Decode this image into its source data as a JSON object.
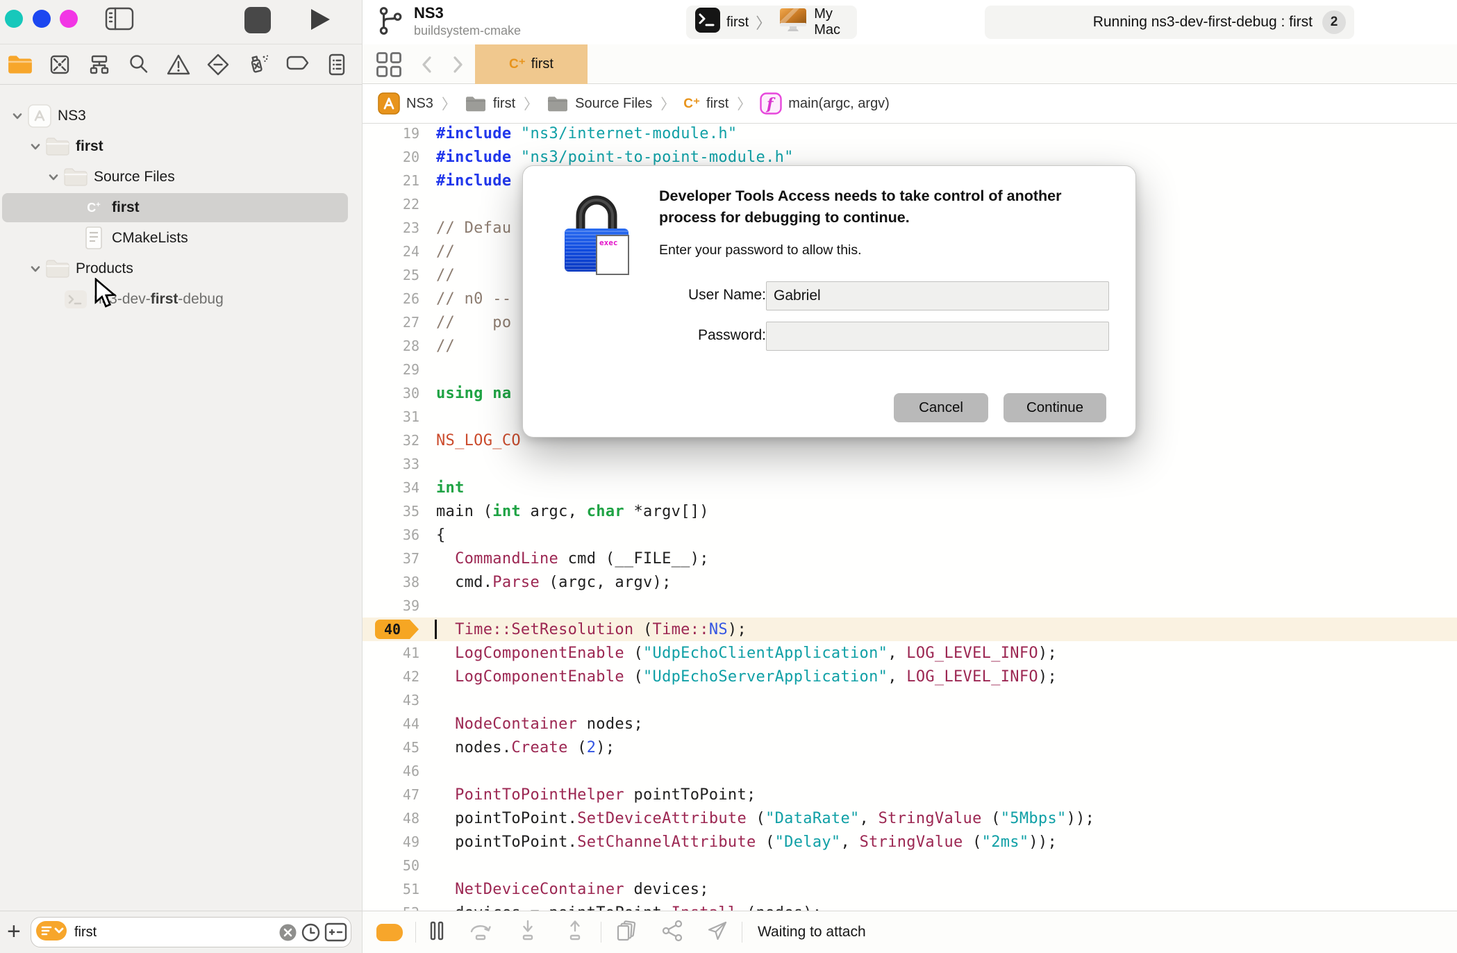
{
  "traffic_lights": {
    "close": "#17c8bb",
    "minimize": "#1c47f0",
    "zoom": "#f235e5"
  },
  "toolbar": {
    "project_name": "NS3",
    "project_subtitle": "buildsystem-cmake",
    "scheme_target": "first",
    "scheme_separator": "〉",
    "scheme_device": "My Mac",
    "status_text": "Running ns3-dev-first-debug : first",
    "status_badge": "2"
  },
  "navigator_icons": [
    {
      "name": "project-navigator-icon",
      "active": true
    },
    {
      "name": "changes-navigator-icon",
      "active": false
    },
    {
      "name": "symbols-navigator-icon",
      "active": false
    },
    {
      "name": "find-navigator-icon",
      "active": false
    },
    {
      "name": "issues-navigator-icon",
      "active": false
    },
    {
      "name": "tests-navigator-icon",
      "active": false
    },
    {
      "name": "debug-navigator-icon",
      "active": false
    },
    {
      "name": "breakpoints-navigator-icon",
      "active": false
    },
    {
      "name": "reports-navigator-icon",
      "active": false
    }
  ],
  "tabbar": {
    "file_badge": "C⁺",
    "active_tab": "first"
  },
  "breadcrumb": [
    {
      "icon": "app",
      "label": "NS3"
    },
    {
      "icon": "folder-sm",
      "label": "first"
    },
    {
      "icon": "folder-sm",
      "label": "Source Files"
    },
    {
      "icon": "cpp-sm",
      "label": "first"
    },
    {
      "icon": "func",
      "label": "main(argc, argv)"
    }
  ],
  "sidebar": {
    "tree": [
      {
        "label": "NS3",
        "icon": "project",
        "level": 0,
        "disclosure": true,
        "bold": false,
        "selected": false
      },
      {
        "label": "first",
        "icon": "folder",
        "level": 1,
        "disclosure": true,
        "bold": true,
        "selected": false
      },
      {
        "label": "Source Files",
        "icon": "folder",
        "level": 2,
        "disclosure": true,
        "bold": false,
        "selected": false
      },
      {
        "label": "first",
        "icon": "cpp",
        "level": 3,
        "disclosure": false,
        "bold": true,
        "selected": true
      },
      {
        "label": "CMakeLists",
        "icon": "doc",
        "level": 3,
        "disclosure": false,
        "bold": false,
        "selected": false
      },
      {
        "label": "Products",
        "icon": "folder",
        "level": 1,
        "disclosure": true,
        "bold": false,
        "selected": false
      },
      {
        "label": "ns3-dev-first-debug",
        "icon": "product",
        "level": 2,
        "disclosure": false,
        "bold": false,
        "selected": false,
        "dim": true,
        "parts": [
          {
            "t": "ns3-dev-",
            "b": false
          },
          {
            "t": "first",
            "b": true
          },
          {
            "t": "-debug",
            "b": false
          }
        ]
      }
    ],
    "filter_value": "first"
  },
  "editor": {
    "current_line": 40,
    "lines": [
      {
        "n": 19,
        "tokens": [
          [
            "pre",
            "#include"
          ],
          [
            "pl",
            " "
          ],
          [
            "str",
            "\"ns3/internet-module.h\""
          ]
        ]
      },
      {
        "n": 20,
        "tokens": [
          [
            "pre",
            "#include"
          ],
          [
            "pl",
            " "
          ],
          [
            "str",
            "\"ns3/point-to-point-module.h\""
          ]
        ]
      },
      {
        "n": 21,
        "tokens": [
          [
            "pre",
            "#include"
          ]
        ]
      },
      {
        "n": 22,
        "tokens": []
      },
      {
        "n": 23,
        "tokens": [
          [
            "com",
            "// Defau"
          ]
        ]
      },
      {
        "n": 24,
        "tokens": [
          [
            "com",
            "//"
          ]
        ]
      },
      {
        "n": 25,
        "tokens": [
          [
            "com",
            "//"
          ]
        ]
      },
      {
        "n": 26,
        "tokens": [
          [
            "com",
            "// n0 --"
          ]
        ]
      },
      {
        "n": 27,
        "tokens": [
          [
            "com",
            "//    po"
          ]
        ]
      },
      {
        "n": 28,
        "tokens": [
          [
            "com",
            "//"
          ]
        ]
      },
      {
        "n": 29,
        "tokens": []
      },
      {
        "n": 30,
        "tokens": [
          [
            "kw",
            "using na"
          ]
        ]
      },
      {
        "n": 31,
        "tokens": []
      },
      {
        "n": 32,
        "tokens": [
          [
            "mac",
            "NS_LOG_CO"
          ]
        ]
      },
      {
        "n": 33,
        "tokens": []
      },
      {
        "n": 34,
        "tokens": [
          [
            "kw",
            "int"
          ]
        ]
      },
      {
        "n": 35,
        "tokens": [
          [
            "pl",
            "main ("
          ],
          [
            "kw",
            "int"
          ],
          [
            "pl",
            " argc, "
          ],
          [
            "kw",
            "char"
          ],
          [
            "pl",
            " *argv[])"
          ]
        ]
      },
      {
        "n": 36,
        "tokens": [
          [
            "pl",
            "{"
          ]
        ]
      },
      {
        "n": 37,
        "tokens": [
          [
            "pl",
            "  "
          ],
          [
            "ty",
            "CommandLine"
          ],
          [
            "pl",
            " cmd (__FILE__);"
          ]
        ]
      },
      {
        "n": 38,
        "tokens": [
          [
            "pl",
            "  cmd."
          ],
          [
            "ty",
            "Parse"
          ],
          [
            "pl",
            " (argc, argv);"
          ]
        ]
      },
      {
        "n": 39,
        "tokens": []
      },
      {
        "n": 40,
        "hl": true,
        "tokens": [
          [
            "pl",
            "  "
          ],
          [
            "ty",
            "Time::SetResolution"
          ],
          [
            "pl",
            " ("
          ],
          [
            "ty",
            "Time::"
          ],
          [
            "num",
            "NS"
          ],
          [
            "pl",
            ");"
          ]
        ]
      },
      {
        "n": 41,
        "tokens": [
          [
            "pl",
            "  "
          ],
          [
            "ty",
            "LogComponentEnable"
          ],
          [
            "pl",
            " ("
          ],
          [
            "str",
            "\"UdpEchoClientApplication\""
          ],
          [
            "pl",
            ", "
          ],
          [
            "ty",
            "LOG_LEVEL_INFO"
          ],
          [
            "pl",
            ");"
          ]
        ]
      },
      {
        "n": 42,
        "tokens": [
          [
            "pl",
            "  "
          ],
          [
            "ty",
            "LogComponentEnable"
          ],
          [
            "pl",
            " ("
          ],
          [
            "str",
            "\"UdpEchoServerApplication\""
          ],
          [
            "pl",
            ", "
          ],
          [
            "ty",
            "LOG_LEVEL_INFO"
          ],
          [
            "pl",
            ");"
          ]
        ]
      },
      {
        "n": 43,
        "tokens": []
      },
      {
        "n": 44,
        "tokens": [
          [
            "pl",
            "  "
          ],
          [
            "ty",
            "NodeContainer"
          ],
          [
            "pl",
            " nodes;"
          ]
        ]
      },
      {
        "n": 45,
        "tokens": [
          [
            "pl",
            "  nodes."
          ],
          [
            "ty",
            "Create"
          ],
          [
            "pl",
            " ("
          ],
          [
            "num",
            "2"
          ],
          [
            "pl",
            ");"
          ]
        ]
      },
      {
        "n": 46,
        "tokens": []
      },
      {
        "n": 47,
        "tokens": [
          [
            "pl",
            "  "
          ],
          [
            "ty",
            "PointToPointHelper"
          ],
          [
            "pl",
            " pointToPoint;"
          ]
        ]
      },
      {
        "n": 48,
        "tokens": [
          [
            "pl",
            "  pointToPoint."
          ],
          [
            "ty",
            "SetDeviceAttribute"
          ],
          [
            "pl",
            " ("
          ],
          [
            "str",
            "\"DataRate\""
          ],
          [
            "pl",
            ", "
          ],
          [
            "ty",
            "StringValue"
          ],
          [
            "pl",
            " ("
          ],
          [
            "str",
            "\"5Mbps\""
          ],
          [
            "pl",
            "));"
          ]
        ]
      },
      {
        "n": 49,
        "tokens": [
          [
            "pl",
            "  pointToPoint."
          ],
          [
            "ty",
            "SetChannelAttribute"
          ],
          [
            "pl",
            " ("
          ],
          [
            "str",
            "\"Delay\""
          ],
          [
            "pl",
            ", "
          ],
          [
            "ty",
            "StringValue"
          ],
          [
            "pl",
            " ("
          ],
          [
            "str",
            "\"2ms\""
          ],
          [
            "pl",
            "));"
          ]
        ]
      },
      {
        "n": 50,
        "tokens": []
      },
      {
        "n": 51,
        "tokens": [
          [
            "pl",
            "  "
          ],
          [
            "ty",
            "NetDeviceContainer"
          ],
          [
            "pl",
            " devices;"
          ]
        ]
      },
      {
        "n": 52,
        "tokens": [
          [
            "pl",
            "  devices = pointToPoint."
          ],
          [
            "ty",
            "Install"
          ],
          [
            "pl",
            " (nodes);"
          ]
        ]
      }
    ]
  },
  "dialog": {
    "title": "Developer Tools Access needs to take control of another process for debugging to continue.",
    "message": "Enter your password to allow this.",
    "username_label": "User Name:",
    "username_value": "Gabriel",
    "password_label": "Password:",
    "password_value": "",
    "cancel_label": "Cancel",
    "continue_label": "Continue",
    "lock_badge": "exec"
  },
  "debugbar": {
    "status": "Waiting to attach"
  },
  "colors": {
    "accent_orange": "#f7a62b",
    "tab_tan": "#f0c88e",
    "badge_orange": "#f6a623",
    "current_line_bg": "#faf2e1"
  }
}
